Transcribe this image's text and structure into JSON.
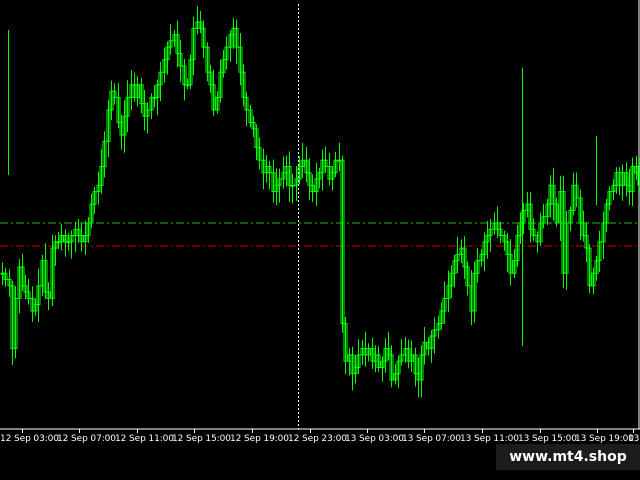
{
  "watermark": "www.mt4.shop",
  "colors": {
    "background": "#000000",
    "candles": "#00ff00",
    "frame": "#ffffff",
    "crosshair": "#ffffff",
    "level_green": "#1db81d",
    "level_red": "#cc0000"
  },
  "chart_data": {
    "type": "candlestick",
    "x_tick_labels": [
      "12 Sep 03:00",
      "12 Sep 07:00",
      "12 Sep 11:00",
      "12 Sep 15:00",
      "12 Sep 19:00",
      "12 Sep 23:00",
      "13 Sep 03:00",
      "13 Sep 07:00",
      "13 Sep 11:00",
      "13 Sep 15:00",
      "13 Sep 19:00",
      "13"
    ],
    "grid": false,
    "price_series": [
      160,
      155,
      150,
      100,
      140,
      165,
      150,
      145,
      140,
      130,
      135,
      150,
      170,
      145,
      140,
      180,
      185,
      185,
      190,
      185,
      185,
      190,
      195,
      190,
      185,
      190,
      200,
      215,
      225,
      230,
      245,
      265,
      290,
      305,
      300,
      280,
      270,
      285,
      300,
      310,
      300,
      310,
      295,
      285,
      290,
      300,
      300,
      310,
      320,
      330,
      340,
      345,
      350,
      335,
      325,
      310,
      310,
      330,
      355,
      360,
      355,
      340,
      320,
      310,
      290,
      300,
      320,
      330,
      340,
      350,
      355,
      340,
      320,
      300,
      290,
      280,
      275,
      260,
      250,
      240,
      245,
      240,
      225,
      230,
      235,
      240,
      245,
      230,
      230,
      235,
      245,
      250,
      240,
      230,
      225,
      235,
      240,
      250,
      245,
      235,
      240,
      250,
      250,
      120,
      90,
      95,
      80,
      85,
      95,
      100,
      95,
      100,
      90,
      95,
      85,
      90,
      100,
      95,
      75,
      80,
      90,
      95,
      100,
      90,
      95,
      80,
      75,
      95,
      105,
      100,
      110,
      115,
      120,
      130,
      140,
      150,
      160,
      170,
      175,
      180,
      165,
      150,
      130,
      160,
      170,
      175,
      185,
      190,
      195,
      200,
      195,
      190,
      185,
      175,
      160,
      170,
      190,
      200,
      210,
      215,
      195,
      190,
      185,
      200,
      205,
      215,
      230,
      215,
      200,
      225,
      160,
      200,
      210,
      230,
      220,
      200,
      190,
      180,
      150,
      160,
      170,
      185,
      200,
      215,
      225,
      230,
      240,
      230,
      240,
      230,
      225,
      245,
      240,
      230
    ],
    "horizontal_levels": [
      {
        "color": "green",
        "style": "dash-dot",
        "level_index": 0
      },
      {
        "color": "red",
        "style": "dash-dot",
        "level_index": 1
      }
    ]
  }
}
